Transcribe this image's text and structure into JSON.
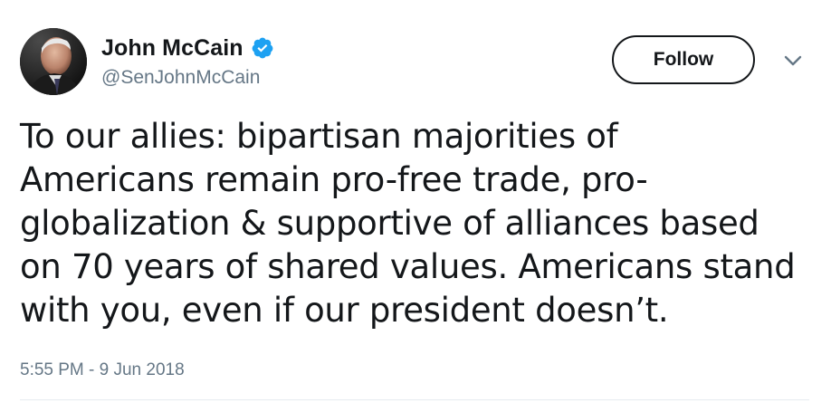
{
  "author": {
    "display_name": "John McCain",
    "handle": "@SenJohnMcCain",
    "verified": true,
    "avatar_icon": "profile-photo"
  },
  "actions": {
    "follow_label": "Follow",
    "more_icon": "chevron-down-icon"
  },
  "tweet": {
    "text": "To our allies: bipartisan majorities of\nAmericans remain pro-free trade, pro-\nglobalization & supportive of alliances based\non 70 years of shared values. Americans stand\nwith you, even if our president doesn’t.",
    "timestamp": "5:55 PM - 9 Jun 2018"
  },
  "colors": {
    "text": "#14171a",
    "secondary": "#657786",
    "verified_blue": "#1da1f2",
    "divider": "#e6ecf0"
  }
}
